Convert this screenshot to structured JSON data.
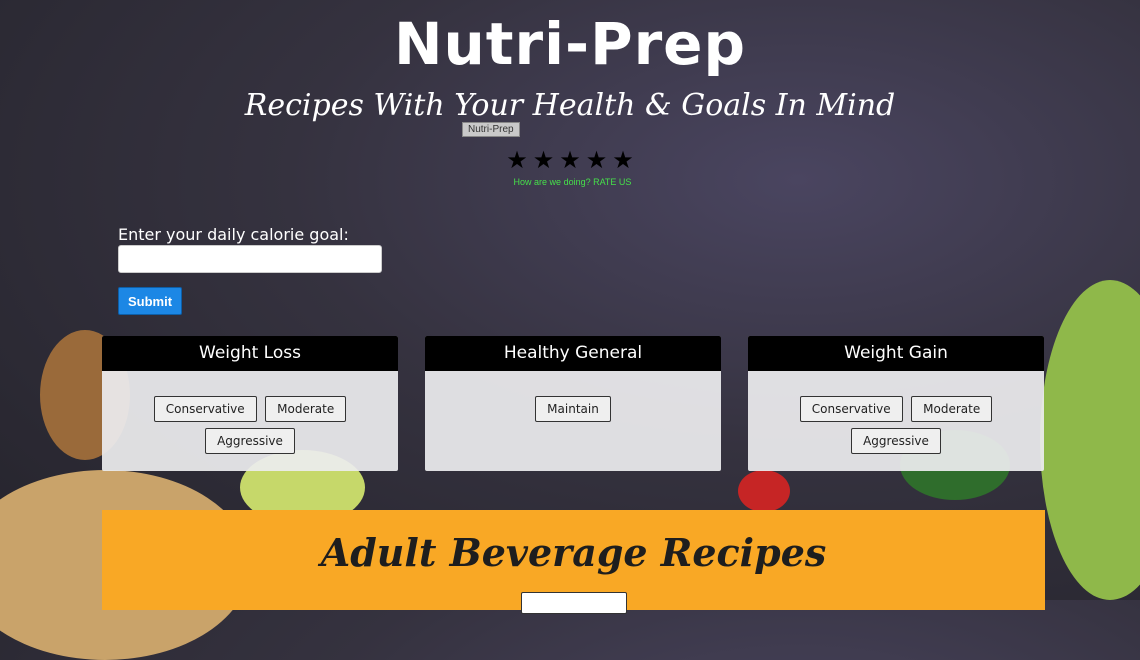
{
  "header": {
    "title": "Nutri-Prep",
    "subtitle": "Recipes With Your Health & Goals In Mind",
    "tooltip": "Nutri-Prep"
  },
  "rating": {
    "stars": "★★★★★",
    "prompt": "How are we doing? RATE US"
  },
  "calorie_form": {
    "label": "Enter your daily calorie goal:",
    "input_value": "",
    "submit_label": "Submit"
  },
  "plans": [
    {
      "title": "Weight Loss",
      "options": [
        "Conservative",
        "Moderate",
        "Aggressive"
      ]
    },
    {
      "title": "Healthy General",
      "options": [
        "Maintain"
      ]
    },
    {
      "title": "Weight Gain",
      "options": [
        "Conservative",
        "Moderate",
        "Aggressive"
      ]
    }
  ],
  "beverage": {
    "title": "Adult Beverage Recipes"
  },
  "colors": {
    "accent_blue": "#1c87e5",
    "rate_green": "#46e04a",
    "beverage_orange": "#f9a825"
  }
}
